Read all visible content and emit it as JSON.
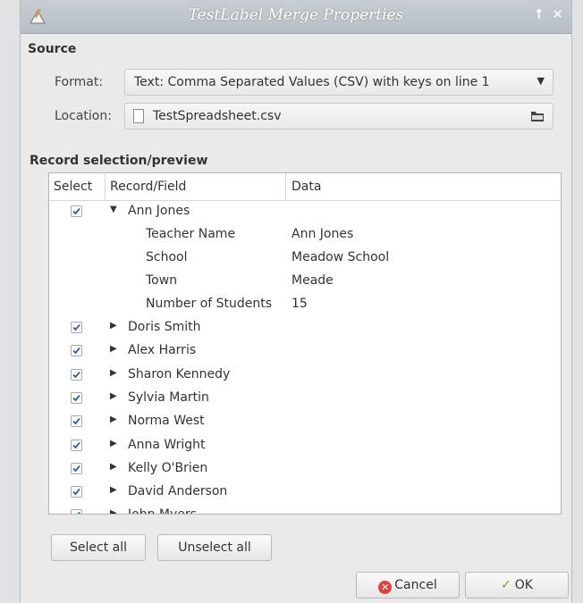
{
  "window": {
    "title": "TestLabel Merge Properties"
  },
  "source": {
    "heading": "Source",
    "format_label": "Format:",
    "format_value": "Text: Comma Separated Values (CSV) with keys on line 1",
    "location_label": "Location:",
    "location_value": "TestSpreadsheet.csv"
  },
  "records": {
    "heading": "Record selection/preview",
    "columns": [
      "Select",
      "Record/Field",
      "Data"
    ],
    "expanded": {
      "name": "Ann Jones",
      "fields": [
        {
          "field": "Teacher Name",
          "data": "Ann Jones"
        },
        {
          "field": "School",
          "data": "Meadow School"
        },
        {
          "field": "Town",
          "data": "Meade"
        },
        {
          "field": "Number of Students",
          "data": "15"
        }
      ]
    },
    "collapsed": [
      "Doris Smith",
      "Alex Harris",
      "Sharon Kennedy",
      "Sylvia Martin",
      "Norma West",
      "Anna Wright",
      "Kelly O'Brien",
      "David Anderson",
      "John Myers"
    ]
  },
  "buttons": {
    "select_all": "Select all",
    "unselect_all": "Unselect all",
    "cancel": "Cancel",
    "ok": "OK"
  }
}
